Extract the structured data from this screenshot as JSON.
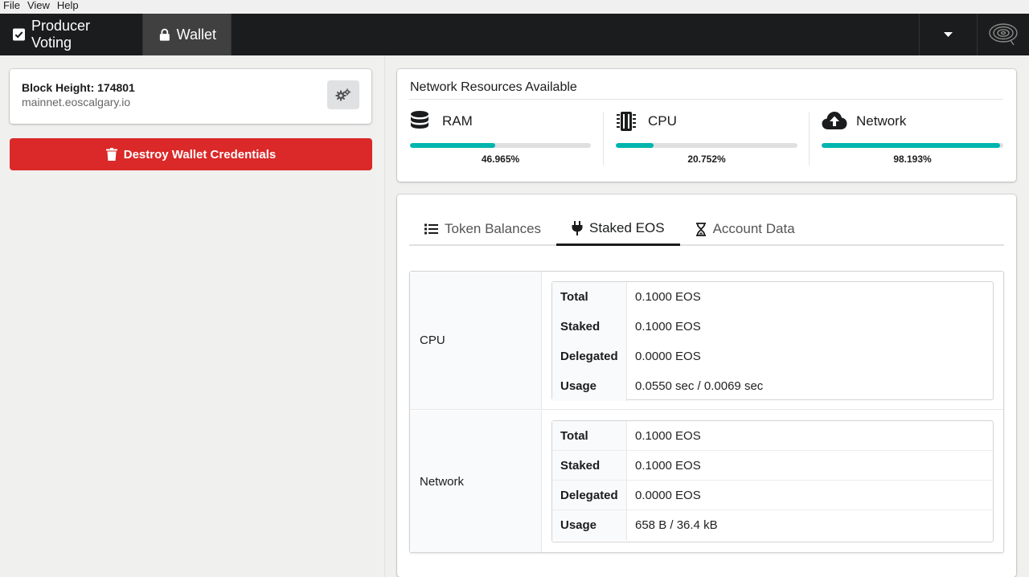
{
  "menu": {
    "items": [
      "File",
      "View",
      "Help"
    ]
  },
  "nav": {
    "voting_label": "Producer Voting",
    "wallet_label": "Wallet"
  },
  "block": {
    "height_label": "Block Height: 174801",
    "node": "mainnet.eoscalgary.io"
  },
  "destroy_label": "Destroy Wallet Credentials",
  "resources": {
    "title": "Network Resources Available",
    "ram": {
      "label": "RAM",
      "percent_text": "46.965%",
      "percent": 46.965
    },
    "cpu": {
      "label": "CPU",
      "percent_text": "20.752%",
      "percent": 20.752
    },
    "network": {
      "label": "Network",
      "percent_text": "98.193%",
      "percent": 98.193
    },
    "bar_color": "#00b5ad"
  },
  "tabs": [
    {
      "label": "Token Balances",
      "icon": "list-icon"
    },
    {
      "label": "Staked EOS",
      "icon": "plug-icon",
      "active": true
    },
    {
      "label": "Account Data",
      "icon": "hourglass-icon"
    }
  ],
  "staked": {
    "cpu": {
      "label": "CPU",
      "rows": [
        {
          "key": "Total",
          "value": "0.1000 EOS"
        },
        {
          "key": "Staked",
          "value": "0.1000 EOS"
        },
        {
          "key": "Delegated",
          "value": "0.0000 EOS"
        },
        {
          "key": "Usage",
          "value": "0.0550 sec / 0.0069 sec"
        }
      ]
    },
    "network": {
      "label": "Network",
      "rows": [
        {
          "key": "Total",
          "value": "0.1000 EOS"
        },
        {
          "key": "Staked",
          "value": "0.1000 EOS"
        },
        {
          "key": "Delegated",
          "value": "0.0000 EOS"
        },
        {
          "key": "Usage",
          "value": "658 B / 36.4 kB"
        }
      ]
    }
  },
  "colors": {
    "nav_bg": "#1b1c1d",
    "destroy": "#db2828",
    "accent": "#00b5ad"
  }
}
